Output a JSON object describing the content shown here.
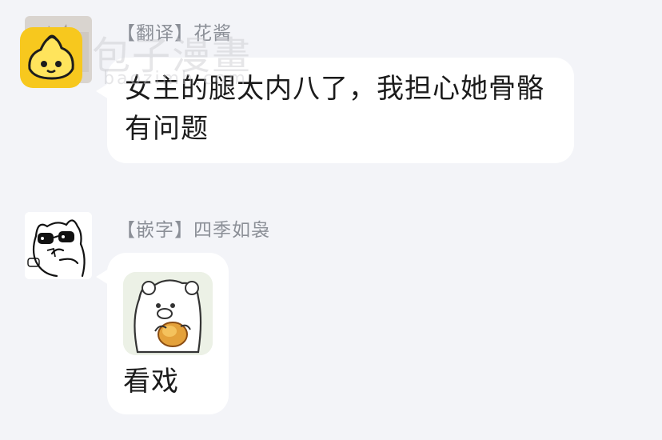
{
  "watermark": {
    "text": "包子漫畫",
    "url": "baozimh.com"
  },
  "messages": [
    {
      "sender": "【翻译】花酱",
      "text": "女主的腿太内八了，我担心她骨骼有问题",
      "avatar_icon": "cat-avatar-icon"
    },
    {
      "sender": "【嵌字】四季如袅",
      "text": "看戏",
      "avatar_icon": "doodle-cat-avatar-icon",
      "sticker_icon": "bear-eating-sticker-icon"
    }
  ],
  "colors": {
    "background": "#f3f4f8",
    "bubble": "#ffffff",
    "sender_text": "#8b8f97",
    "message_text": "#1b1b1b"
  }
}
